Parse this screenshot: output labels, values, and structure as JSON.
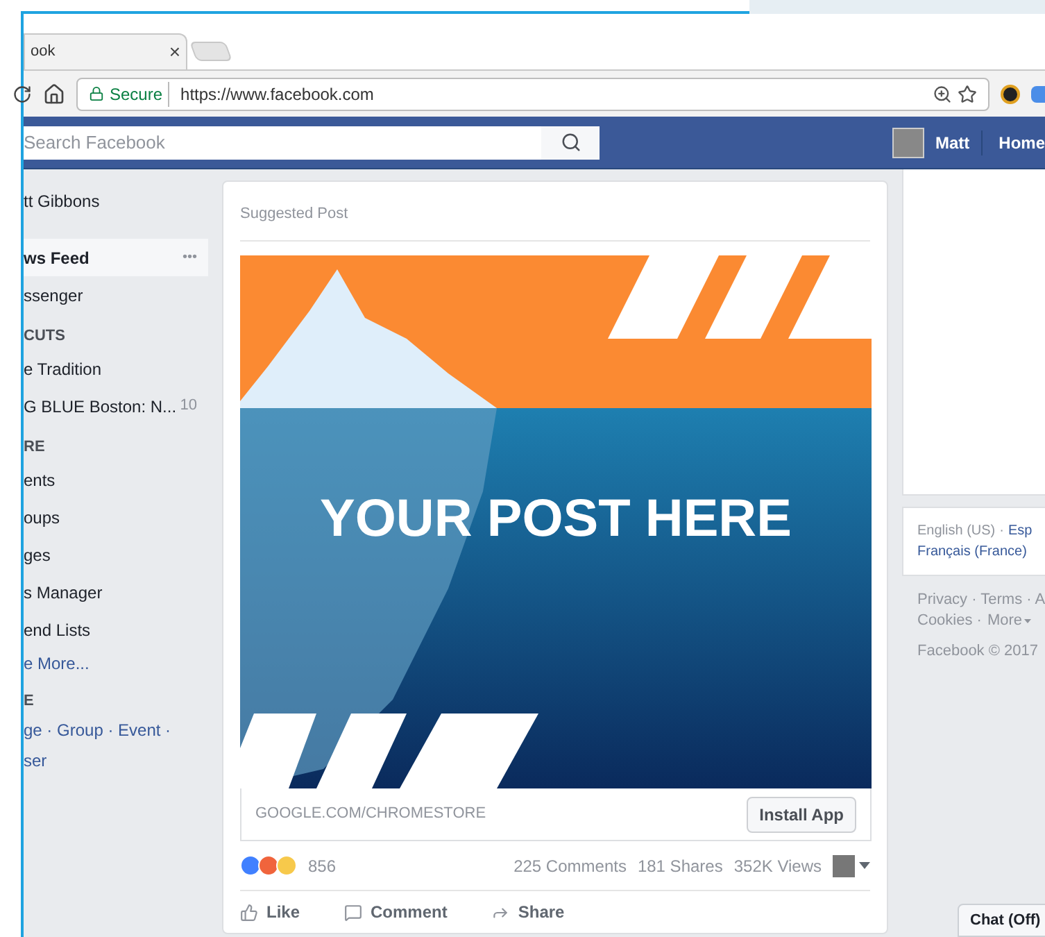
{
  "browser": {
    "tab_title": "ook",
    "tab_close": "×",
    "security": "Secure",
    "url": "https://www.facebook.com"
  },
  "topbar": {
    "search_placeholder": "Search Facebook",
    "user": "Matt",
    "home": "Home"
  },
  "sidebar": [
    {
      "kind": "profile",
      "label": "tt Gibbons"
    },
    {
      "kind": "item",
      "label": "ws Feed",
      "selected": true,
      "extra": "•••"
    },
    {
      "kind": "item",
      "label": "ssenger",
      "selected": false
    },
    {
      "kind": "header",
      "label": "CUTS"
    },
    {
      "kind": "item",
      "label": "e Tradition",
      "selected": false
    },
    {
      "kind": "item",
      "label": "G BLUE Boston: N...",
      "selected": false,
      "count": "10"
    },
    {
      "kind": "header",
      "label": "RE"
    },
    {
      "kind": "item",
      "label": "ents",
      "selected": false
    },
    {
      "kind": "item",
      "label": "oups",
      "selected": false
    },
    {
      "kind": "item",
      "label": "ges",
      "selected": false
    },
    {
      "kind": "item",
      "label": "s Manager",
      "selected": false
    },
    {
      "kind": "item",
      "label": "end Lists",
      "selected": false
    },
    {
      "kind": "link",
      "label": "e More..."
    },
    {
      "kind": "header",
      "label": "E"
    },
    {
      "kind": "link",
      "label": "ge · Group · Event ·"
    },
    {
      "kind": "link",
      "label": "ser"
    }
  ],
  "post": {
    "header": "Suggested Post",
    "headline": "YOUR POST HERE",
    "domain": "GOOGLE.COM/CHROMESTORE",
    "cta": "Install App",
    "reactions": "856",
    "stats": [
      "225 Comments",
      "181 Shares",
      "352K Views"
    ],
    "actions": [
      {
        "kind": "like",
        "label": "Like"
      },
      {
        "kind": "comment",
        "label": "Comment"
      },
      {
        "kind": "share",
        "label": "Share"
      }
    ]
  },
  "languages": {
    "current": "English (US)",
    "separator": "·",
    "others": [
      "Esp",
      "Français (France)"
    ]
  },
  "footer": {
    "links": "Privacy · Terms · A",
    "links2": "Cookies ·",
    "more": "More",
    "copyright": "Facebook © 2017"
  },
  "chat": "Chat (Off)"
}
